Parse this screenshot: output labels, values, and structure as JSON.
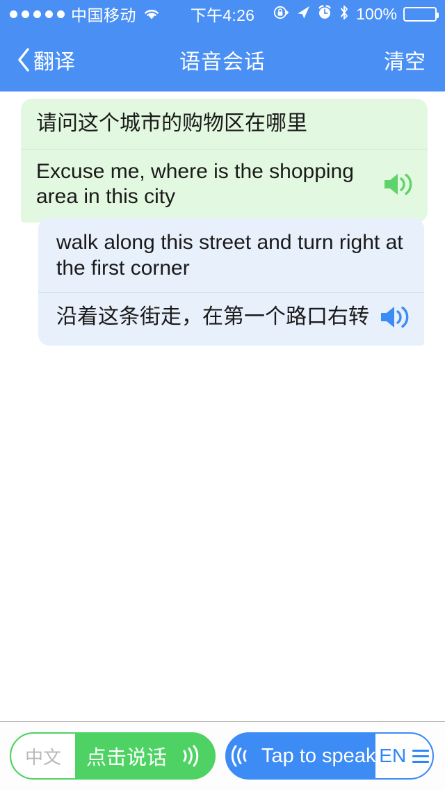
{
  "status_bar": {
    "signal_dots": 5,
    "carrier": "中国移动",
    "wifi_icon": "wifi-icon",
    "time": "下午4:26",
    "rotation_lock_icon": "rotation-lock-icon",
    "location_icon": "location-arrow-icon",
    "alarm_icon": "alarm-clock-icon",
    "bluetooth_icon": "bluetooth-icon",
    "battery_percent": "100%",
    "battery_icon": "battery-full-icon",
    "bg_color": "#4a90f4"
  },
  "nav_bar": {
    "back_icon": "chevron-left-icon",
    "back_label": "翻译",
    "title": "语音会话",
    "action_label": "清空",
    "bg_color": "#4a90f4"
  },
  "conversation": {
    "messages": [
      {
        "side": "left",
        "style": "green",
        "bg_color": "#e3f8e0",
        "source_text": "请问这个城市的购物区在哪里",
        "translated_text": "Excuse me, where is the shopping area in this city",
        "speaker_icon": "speaker-icon",
        "speaker_color": "#5ed36b"
      },
      {
        "side": "right",
        "style": "blue",
        "bg_color": "#e8f0fb",
        "source_text": "walk along this street and turn right at the first corner",
        "translated_text": "沿着这条街走，在第一个路口右转",
        "speaker_icon": "speaker-icon",
        "speaker_color": "#3d8bf5"
      }
    ]
  },
  "bottom_bar": {
    "zh_button": {
      "lang_code": "中文",
      "label": "点击说话",
      "waves_icon": "sound-waves-right-icon",
      "color": "#4ed263"
    },
    "en_button": {
      "label": "Tap to speak",
      "lang_code": "EN",
      "waves_icon": "sound-waves-left-icon",
      "menu_icon": "hamburger-menu-icon",
      "color": "#3d8bf5"
    }
  }
}
